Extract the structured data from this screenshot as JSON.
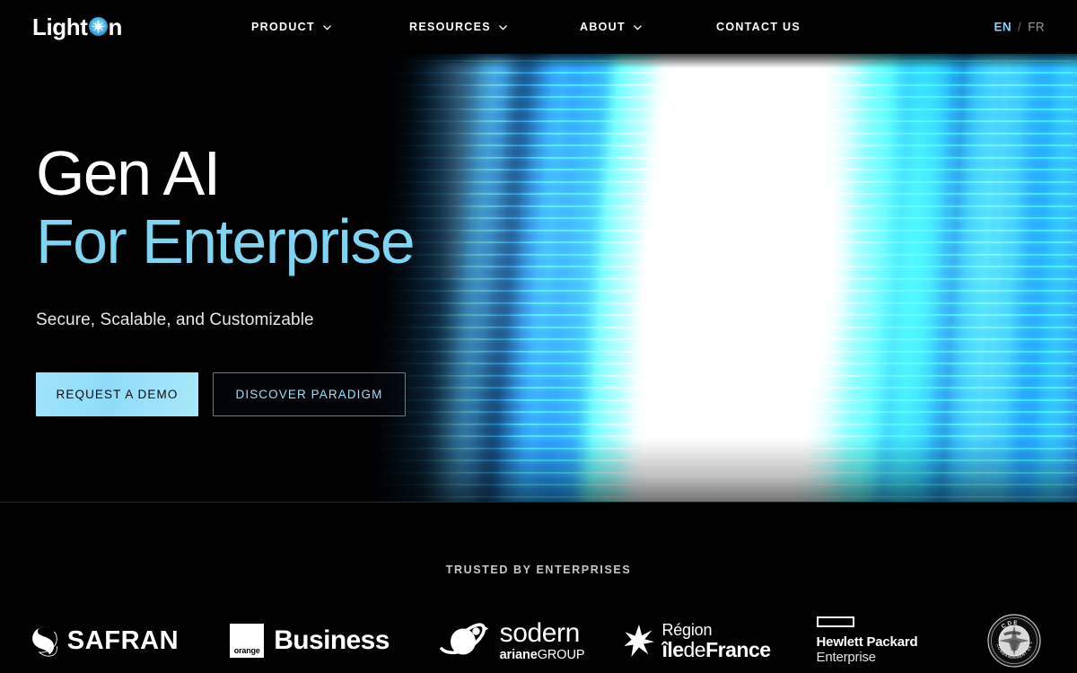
{
  "brand": {
    "part1": "Light",
    "orb_icon": "star-sparkle-icon",
    "part2": "n"
  },
  "nav": {
    "items": [
      {
        "label": "PRODUCT",
        "has_dropdown": true,
        "icon": "chevron-down-icon"
      },
      {
        "label": "RESOURCES",
        "has_dropdown": true,
        "icon": "chevron-down-icon"
      },
      {
        "label": "ABOUT",
        "has_dropdown": true,
        "icon": "chevron-down-icon"
      },
      {
        "label": "CONTACT US",
        "has_dropdown": false
      }
    ],
    "language": {
      "active": "EN",
      "separator": "/",
      "inactive": "FR",
      "active_color": "#7fd4f2",
      "inactive_color": "#9a9a9a"
    }
  },
  "hero": {
    "title_line1": "Gen AI",
    "title_line2": "For Enterprise",
    "title_line1_color": "#ffffff",
    "title_line2_color": "#7fd4f2",
    "subtitle": "Secure, Scalable, and Customizable",
    "primary_button": "REQUEST A DEMO",
    "secondary_button": "DISCOVER PARADIGM",
    "primary_button_color": "#9fe4fb",
    "secondary_button_text_color": "#9fdff5",
    "background_description": "abstract blue light streaks gradient"
  },
  "trusted": {
    "label": "TRUSTED BY ENTERPRISES",
    "logos": [
      {
        "name": "safran",
        "icon": "safran-swirl-icon",
        "text": "SAFRAN"
      },
      {
        "name": "orange-business",
        "icon": "orange-square-icon",
        "badge_text": "orange",
        "text": "Business"
      },
      {
        "name": "sodern-arianegroup",
        "icon": "sodern-planet-icon",
        "text": "sodern",
        "sub_bold": "ariane",
        "sub_light": "GROUP"
      },
      {
        "name": "region-ile-de-france",
        "icon": "seven-point-star-icon",
        "line1": "Région",
        "line2_bold_a": "île",
        "line2_light": "de",
        "line2_bold_b": "France"
      },
      {
        "name": "hewlett-packard-enterprise",
        "icon": "hpe-rectangle-icon",
        "line1": "Hewlett Packard",
        "line2": "Enterprise"
      },
      {
        "name": "commandement-de-lespace",
        "icon": "cde-seal-icon",
        "seal_top": "CDE",
        "seal_bottom": "COMMANDEMENT DE L'ESPACE"
      }
    ]
  }
}
